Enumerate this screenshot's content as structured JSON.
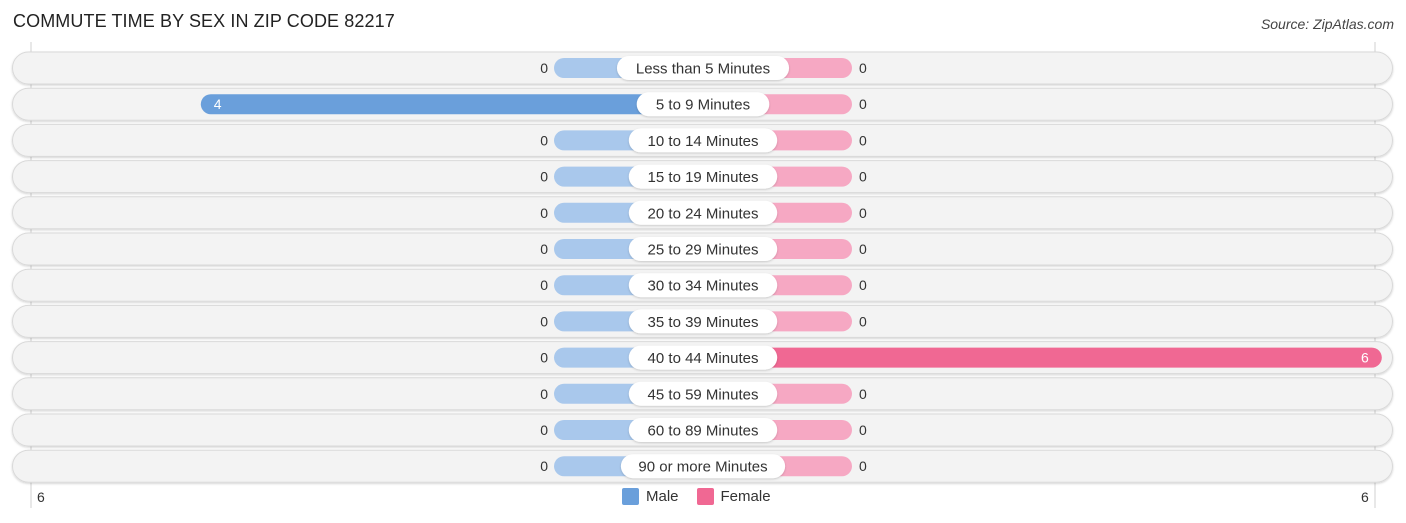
{
  "header": {
    "title": "COMMUTE TIME BY SEX IN ZIP CODE 82217",
    "source": "Source: ZipAtlas.com"
  },
  "colors": {
    "male": "#6a9fdb",
    "male_light": "#a9c8ec",
    "female": "#f06893",
    "female_light": "#f6a8c3",
    "track": "#f3f3f3",
    "track_border": "#d9d9d9"
  },
  "chart_data": {
    "type": "bar",
    "orientation": "horizontal-diverging",
    "title": "COMMUTE TIME BY SEX IN ZIP CODE 82217",
    "categories": [
      "Less than 5 Minutes",
      "5 to 9 Minutes",
      "10 to 14 Minutes",
      "15 to 19 Minutes",
      "20 to 24 Minutes",
      "25 to 29 Minutes",
      "30 to 34 Minutes",
      "35 to 39 Minutes",
      "40 to 44 Minutes",
      "45 to 59 Minutes",
      "60 to 89 Minutes",
      "90 or more Minutes"
    ],
    "series": [
      {
        "name": "Male",
        "values": [
          0,
          4,
          0,
          0,
          0,
          0,
          0,
          0,
          0,
          0,
          0,
          0
        ]
      },
      {
        "name": "Female",
        "values": [
          0,
          0,
          0,
          0,
          0,
          0,
          0,
          0,
          6,
          0,
          0,
          0
        ]
      }
    ],
    "axis": {
      "left_label": "6",
      "right_label": "6",
      "max": 6
    },
    "legend": {
      "position": "bottom-center",
      "entries": [
        "Male",
        "Female"
      ]
    }
  }
}
